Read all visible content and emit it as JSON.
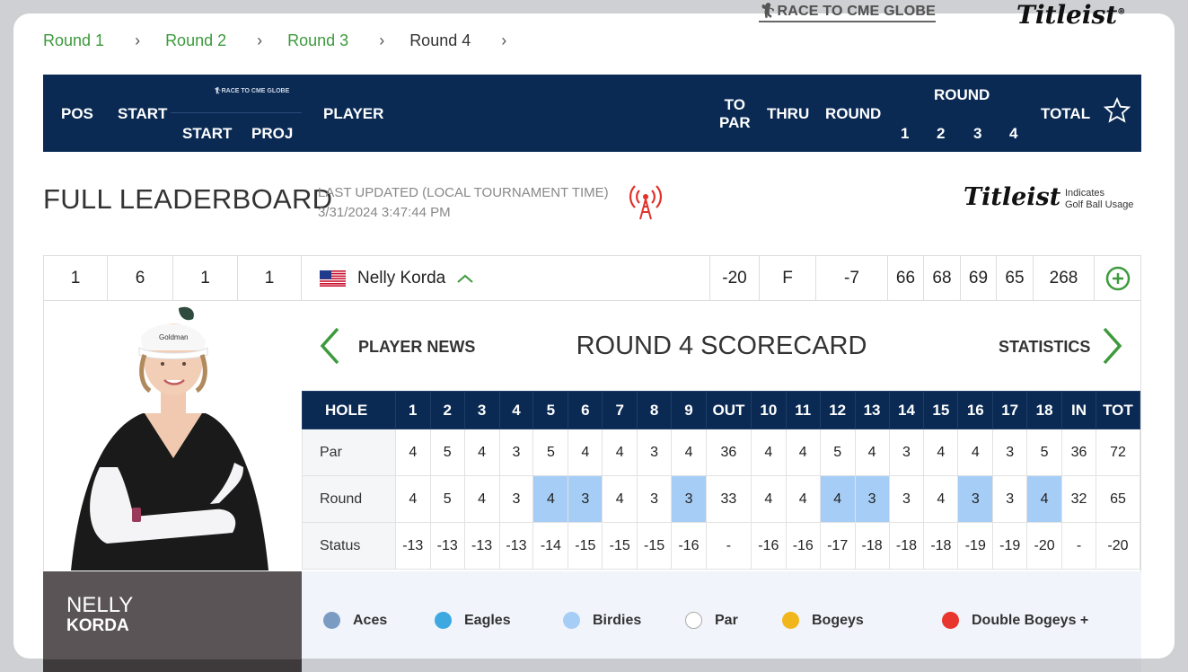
{
  "brands": {
    "race_logo": "RACE TO CME GLOBE",
    "titleist": "Titleist",
    "race_small": "RACE TO CME GLOBE"
  },
  "breadcrumb": [
    "Round 1",
    "Round 2",
    "Round 3",
    "Round 4"
  ],
  "header": {
    "pos": "POS",
    "start": "START",
    "start2": "START",
    "proj": "PROJ",
    "player": "PLAYER",
    "to_par_1": "TO",
    "to_par_2": "PAR",
    "thru": "THRU",
    "round": "ROUND",
    "round_group": "ROUND",
    "rounds": [
      "1",
      "2",
      "3",
      "4"
    ],
    "total": "TOTAL"
  },
  "leaderboard": {
    "title": "FULL LEADERBOARD",
    "updated_label": "LAST UPDATED (LOCAL TOURNAMENT TIME)",
    "updated_value": "3/31/2024 3:47:44 PM",
    "indicates_1": "Indicates",
    "indicates_2": "Golf Ball Usage"
  },
  "player": {
    "pos": "1",
    "start": "6",
    "race_start": "1",
    "race_proj": "1",
    "name": "Nelly Korda",
    "to_par": "-20",
    "thru": "F",
    "round": "-7",
    "rounds": [
      "66",
      "68",
      "69",
      "65"
    ],
    "total": "268",
    "first": "NELLY",
    "last": "KORDA"
  },
  "scorecard": {
    "title": "ROUND 4 SCORECARD",
    "player_news": "PLAYER NEWS",
    "statistics": "STATISTICS",
    "headers": [
      "HOLE",
      "1",
      "2",
      "3",
      "4",
      "5",
      "6",
      "7",
      "8",
      "9",
      "OUT",
      "10",
      "11",
      "12",
      "13",
      "14",
      "15",
      "16",
      "17",
      "18",
      "IN",
      "TOT"
    ],
    "rows": [
      {
        "label": "Par",
        "values": [
          "4",
          "5",
          "4",
          "3",
          "5",
          "4",
          "4",
          "3",
          "4",
          "36",
          "4",
          "4",
          "5",
          "4",
          "3",
          "4",
          "4",
          "3",
          "5",
          "36",
          "72"
        ]
      },
      {
        "label": "Round",
        "values": [
          "4",
          "5",
          "4",
          "3",
          "4",
          "3",
          "4",
          "3",
          "3",
          "33",
          "4",
          "4",
          "4",
          "3",
          "3",
          "4",
          "3",
          "3",
          "4",
          "32",
          "65"
        ]
      },
      {
        "label": "Status",
        "values": [
          "-13",
          "-13",
          "-13",
          "-13",
          "-14",
          "-15",
          "-15",
          "-15",
          "-16",
          "-",
          "-16",
          "-16",
          "-17",
          "-18",
          "-18",
          "-18",
          "-19",
          "-19",
          "-20",
          "-",
          "-20"
        ]
      }
    ],
    "birdie_holes": [
      4,
      5,
      8,
      12,
      13,
      16,
      18
    ]
  },
  "legend": [
    {
      "label": "Aces",
      "color": "#7a9cc2"
    },
    {
      "label": "Eagles",
      "color": "#3ea8e0"
    },
    {
      "label": "Birdies",
      "color": "#a6cdf5"
    },
    {
      "label": "Par",
      "color": "#ffffff"
    },
    {
      "label": "Bogeys",
      "color": "#f2b61d"
    },
    {
      "label": "Double Bogeys +",
      "color": "#e8352d"
    }
  ],
  "colors": {
    "navy": "#0a2a54",
    "green": "#3d9a3d",
    "birdie": "#a6cdf5"
  }
}
